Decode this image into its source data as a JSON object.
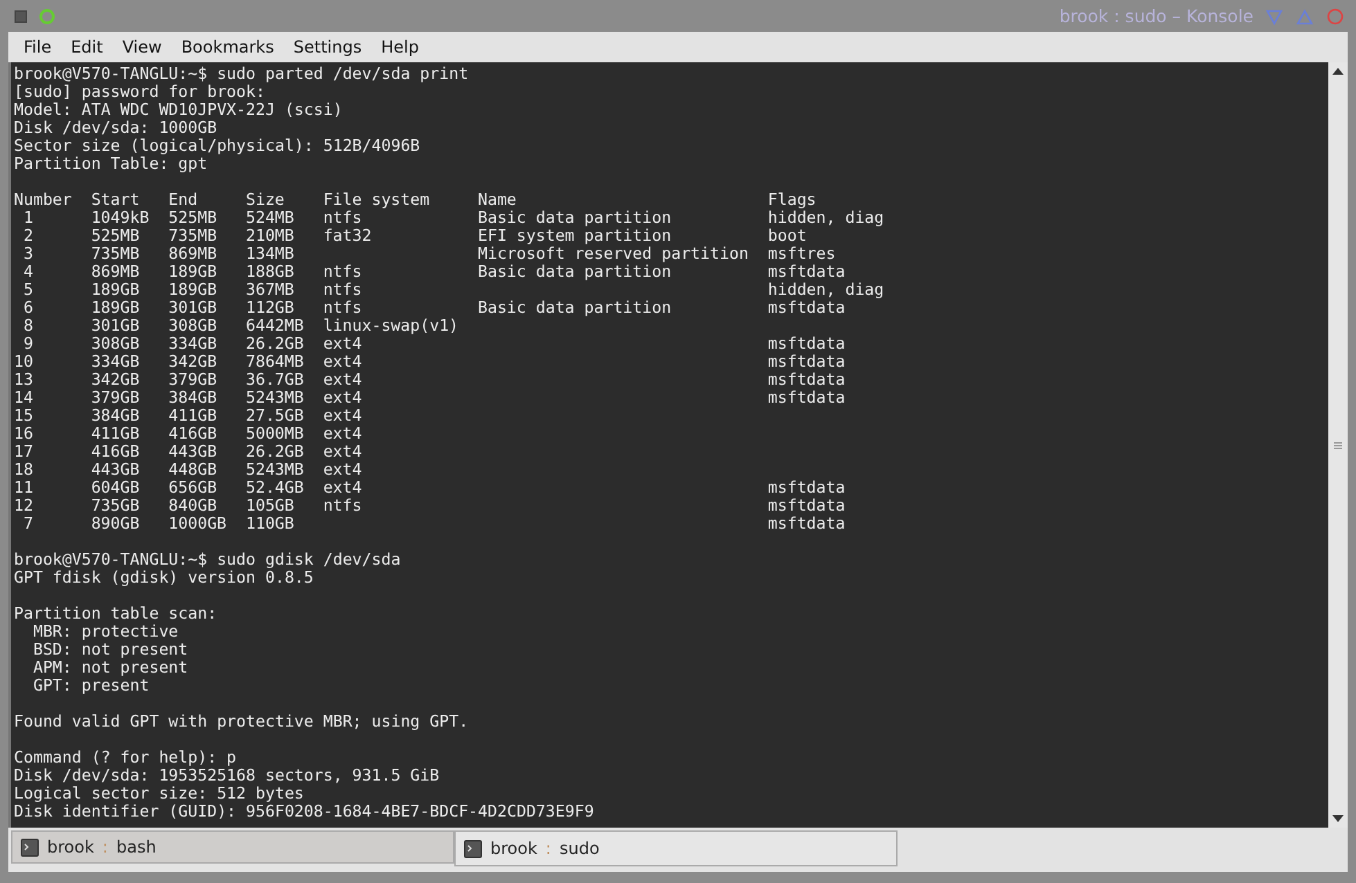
{
  "window": {
    "title": "brook : sudo – Konsole"
  },
  "menu": [
    "File",
    "Edit",
    "View",
    "Bookmarks",
    "Settings",
    "Help"
  ],
  "terminal": {
    "lines_before": [
      "brook@V570-TANGLU:~$ sudo parted /dev/sda print",
      "[sudo] password for brook:",
      "Model: ATA WDC WD10JPVX-22J (scsi)",
      "Disk /dev/sda: 1000GB",
      "Sector size (logical/physical): 512B/4096B",
      "Partition Table: gpt"
    ],
    "partition_table": {
      "columns": [
        "Number",
        "Start",
        "End",
        "Size",
        "File system",
        "Name",
        "Flags"
      ],
      "rows": [
        [
          "1",
          "1049kB",
          "525MB",
          "524MB",
          "ntfs",
          "Basic data partition",
          "hidden, diag"
        ],
        [
          "2",
          "525MB",
          "735MB",
          "210MB",
          "fat32",
          "EFI system partition",
          "boot"
        ],
        [
          "3",
          "735MB",
          "869MB",
          "134MB",
          "",
          "Microsoft reserved partition",
          "msftres"
        ],
        [
          "4",
          "869MB",
          "189GB",
          "188GB",
          "ntfs",
          "Basic data partition",
          "msftdata"
        ],
        [
          "5",
          "189GB",
          "189GB",
          "367MB",
          "ntfs",
          "",
          "hidden, diag"
        ],
        [
          "6",
          "189GB",
          "301GB",
          "112GB",
          "ntfs",
          "Basic data partition",
          "msftdata"
        ],
        [
          "8",
          "301GB",
          "308GB",
          "6442MB",
          "linux-swap(v1)",
          "",
          ""
        ],
        [
          "9",
          "308GB",
          "334GB",
          "26.2GB",
          "ext4",
          "",
          "msftdata"
        ],
        [
          "10",
          "334GB",
          "342GB",
          "7864MB",
          "ext4",
          "",
          "msftdata"
        ],
        [
          "13",
          "342GB",
          "379GB",
          "36.7GB",
          "ext4",
          "",
          "msftdata"
        ],
        [
          "14",
          "379GB",
          "384GB",
          "5243MB",
          "ext4",
          "",
          "msftdata"
        ],
        [
          "15",
          "384GB",
          "411GB",
          "27.5GB",
          "ext4",
          "",
          ""
        ],
        [
          "16",
          "411GB",
          "416GB",
          "5000MB",
          "ext4",
          "",
          ""
        ],
        [
          "17",
          "416GB",
          "443GB",
          "26.2GB",
          "ext4",
          "",
          ""
        ],
        [
          "18",
          "443GB",
          "448GB",
          "5243MB",
          "ext4",
          "",
          ""
        ],
        [
          "11",
          "604GB",
          "656GB",
          "52.4GB",
          "ext4",
          "",
          "msftdata"
        ],
        [
          "12",
          "735GB",
          "840GB",
          "105GB",
          "ntfs",
          "",
          "msftdata"
        ],
        [
          "7",
          "890GB",
          "1000GB",
          "110GB",
          "",
          "",
          "msftdata"
        ]
      ]
    },
    "blocks_after": [
      [
        "brook@V570-TANGLU:~$ sudo gdisk /dev/sda",
        "GPT fdisk (gdisk) version 0.8.5"
      ],
      [
        "Partition table scan:",
        "  MBR: protective",
        "  BSD: not present",
        "  APM: not present",
        "  GPT: present"
      ],
      [
        "Found valid GPT with protective MBR; using GPT."
      ],
      [
        "Command (? for help): p",
        "Disk /dev/sda: 1953525168 sectors, 931.5 GiB",
        "Logical sector size: 512 bytes",
        "Disk identifier (GUID): 956F0208-1684-4BE7-BDCF-4D2CDD73E9F9"
      ]
    ]
  },
  "tabs": [
    {
      "user": "brook",
      "separator": ":",
      "name": "bash",
      "selected": false
    },
    {
      "user": "brook",
      "separator": ":",
      "name": "sudo",
      "selected": true
    }
  ]
}
